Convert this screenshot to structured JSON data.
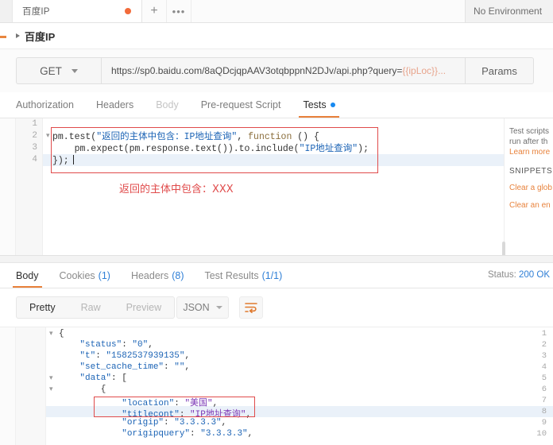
{
  "tabbar": {
    "tab_label": "百度IP",
    "unsaved_indicator": "unsaved-dot",
    "add_label": "+",
    "more_label": "•••",
    "environment": "No Environment"
  },
  "breadcrumb": {
    "caret": "collapse-caret",
    "title": "百度IP"
  },
  "urlbar": {
    "method": "GET",
    "url_text": "https://sp0.baidu.com/8aQDcjqpAAV3otqbppnN2DJv/api.php?query=",
    "url_variable": "{{ipLoc}}",
    "url_ellipsis": "...",
    "params_label": "Params",
    "send_label": ""
  },
  "request_tabs": [
    {
      "label": "Authorization",
      "state": "normal"
    },
    {
      "label": "Headers",
      "state": "normal"
    },
    {
      "label": "Body",
      "state": "dim"
    },
    {
      "label": "Pre-request Script",
      "state": "normal"
    },
    {
      "label": "Tests",
      "state": "active",
      "dot": true
    }
  ],
  "editor": {
    "line_numbers": [
      "1",
      "2",
      "3",
      "4"
    ],
    "fold_markers": [
      "",
      "▾",
      "",
      ""
    ],
    "highlighted_line": 4,
    "code": [
      {
        "n": 1,
        "segments": []
      },
      {
        "n": 2,
        "segments": [
          {
            "t": "pm.test(",
            "c": "plain"
          },
          {
            "t": "\"返回的主体中包含：IP地址查询\"",
            "c": "str"
          },
          {
            "t": ", ",
            "c": "plain"
          },
          {
            "t": "function",
            "c": "kw"
          },
          {
            "t": " () {",
            "c": "plain"
          }
        ]
      },
      {
        "n": 3,
        "segments": [
          {
            "t": "    pm.expect(pm.response.text()).to.include(",
            "c": "plain"
          },
          {
            "t": "\"IP地址查询\"",
            "c": "str"
          },
          {
            "t": ");",
            "c": "plain"
          }
        ]
      },
      {
        "n": 4,
        "segments": [
          {
            "t": "});",
            "c": "plain"
          }
        ]
      }
    ],
    "annotation": "返回的主体中包含：XXX",
    "annotation_color": "#e04b4b",
    "highlight_box_color": "#e04b4b"
  },
  "editor_sidebar": {
    "description_line1": "Test scripts",
    "description_line2": "run after th",
    "learn_more": "Learn more",
    "snippets_heading": "SNIPPETS",
    "snippets": [
      "Clear a glob",
      "Clear an en"
    ]
  },
  "response_tabs": [
    {
      "label": "Body",
      "count": "",
      "state": "active"
    },
    {
      "label": "Cookies",
      "count": "(1)",
      "state": "normal"
    },
    {
      "label": "Headers",
      "count": "(8)",
      "state": "normal"
    },
    {
      "label": "Test Results",
      "count": "(1/1)",
      "state": "normal"
    }
  ],
  "status": {
    "label": "Status:",
    "value": "200 OK"
  },
  "format_bar": {
    "modes": [
      {
        "label": "Pretty",
        "active": true
      },
      {
        "label": "Raw",
        "active": false
      },
      {
        "label": "Preview",
        "active": false
      }
    ],
    "language": "JSON",
    "wrap_icon": "word-wrap-icon"
  },
  "response_body": {
    "highlighted_line": 8,
    "lines": [
      {
        "n": "1",
        "fold": "▾",
        "segments": [
          {
            "t": "{",
            "c": "punct"
          }
        ]
      },
      {
        "n": "2",
        "fold": "",
        "segments": [
          {
            "t": "    ",
            "c": "punct"
          },
          {
            "t": "\"status\"",
            "c": "key"
          },
          {
            "t": ": ",
            "c": "punct"
          },
          {
            "t": "\"0\"",
            "c": "str"
          },
          {
            "t": ",",
            "c": "punct"
          }
        ]
      },
      {
        "n": "3",
        "fold": "",
        "segments": [
          {
            "t": "    ",
            "c": "punct"
          },
          {
            "t": "\"t\"",
            "c": "key"
          },
          {
            "t": ": ",
            "c": "punct"
          },
          {
            "t": "\"1582537939135\"",
            "c": "str"
          },
          {
            "t": ",",
            "c": "punct"
          }
        ]
      },
      {
        "n": "4",
        "fold": "",
        "segments": [
          {
            "t": "    ",
            "c": "punct"
          },
          {
            "t": "\"set_cache_time\"",
            "c": "key"
          },
          {
            "t": ": ",
            "c": "punct"
          },
          {
            "t": "\"\"",
            "c": "str"
          },
          {
            "t": ",",
            "c": "punct"
          }
        ]
      },
      {
        "n": "5",
        "fold": "▾",
        "segments": [
          {
            "t": "    ",
            "c": "punct"
          },
          {
            "t": "\"data\"",
            "c": "key"
          },
          {
            "t": ": [",
            "c": "punct"
          }
        ]
      },
      {
        "n": "6",
        "fold": "▾",
        "segments": [
          {
            "t": "        {",
            "c": "punct"
          }
        ]
      },
      {
        "n": "7",
        "fold": "",
        "segments": [
          {
            "t": "            ",
            "c": "punct"
          },
          {
            "t": "\"location\"",
            "c": "key"
          },
          {
            "t": ": ",
            "c": "punct"
          },
          {
            "t": "\"美国\"",
            "c": "cn"
          },
          {
            "t": ",",
            "c": "punct"
          }
        ]
      },
      {
        "n": "8",
        "fold": "",
        "segments": [
          {
            "t": "            ",
            "c": "punct"
          },
          {
            "t": "\"titlecont\"",
            "c": "key"
          },
          {
            "t": ": ",
            "c": "punct"
          },
          {
            "t": "\"IP地址查询\"",
            "c": "cn"
          },
          {
            "t": ",",
            "c": "punct"
          }
        ]
      },
      {
        "n": "9",
        "fold": "",
        "segments": [
          {
            "t": "            ",
            "c": "punct"
          },
          {
            "t": "\"origip\"",
            "c": "key"
          },
          {
            "t": ": ",
            "c": "punct"
          },
          {
            "t": "\"3.3.3.3\"",
            "c": "str"
          },
          {
            "t": ",",
            "c": "punct"
          }
        ]
      },
      {
        "n": "10",
        "fold": "",
        "segments": [
          {
            "t": "            ",
            "c": "punct"
          },
          {
            "t": "\"origipquery\"",
            "c": "key"
          },
          {
            "t": ": ",
            "c": "punct"
          },
          {
            "t": "\"3.3.3.3\"",
            "c": "str"
          },
          {
            "t": ",",
            "c": "punct"
          }
        ]
      }
    ],
    "highlight_box_color": "#e04b4b"
  }
}
